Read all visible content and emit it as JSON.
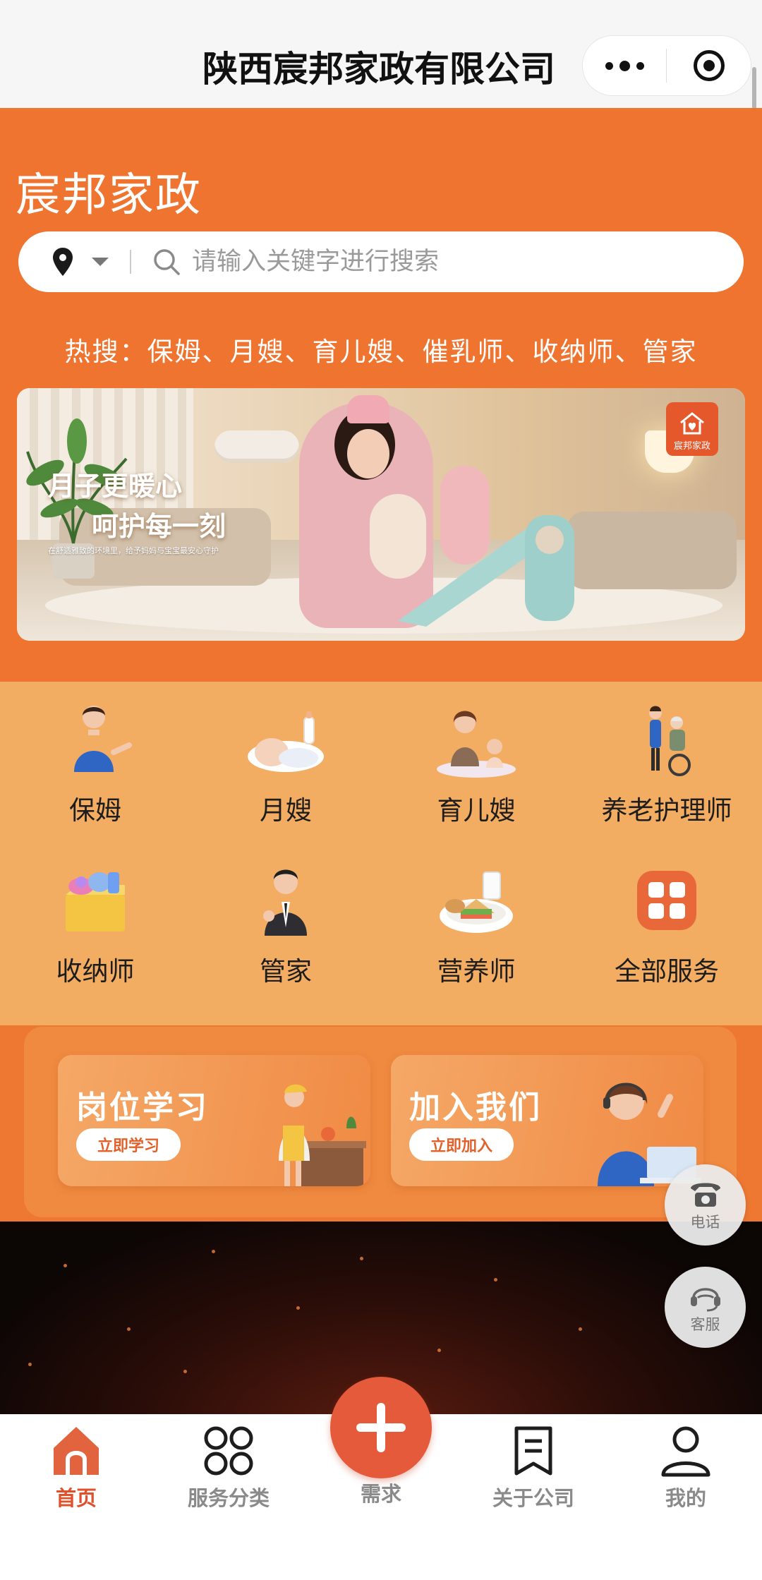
{
  "nav": {
    "title": "陕西宸邦家政有限公司"
  },
  "header": {
    "brand": "宸邦家政",
    "search_placeholder": "请输入关键字进行搜索",
    "hot_search": "热搜：保姆、月嫂、育儿嫂、催乳师、收纳师、管家"
  },
  "banner": {
    "line1": "月子更暖心",
    "line2": "呵护每一刻",
    "line3": "在舒适雅致的环境里，给予妈妈与宝宝最安心守护",
    "logo_text": "宸邦家政"
  },
  "services": [
    {
      "label": "保姆",
      "icon": "nanny-icon"
    },
    {
      "label": "月嫂",
      "icon": "newborn-icon"
    },
    {
      "label": "育儿嫂",
      "icon": "childcare-icon"
    },
    {
      "label": "养老护理师",
      "icon": "elderly-care-icon"
    },
    {
      "label": "收纳师",
      "icon": "organizer-icon"
    },
    {
      "label": "管家",
      "icon": "butler-icon"
    },
    {
      "label": "营养师",
      "icon": "nutritionist-icon"
    },
    {
      "label": "全部服务",
      "icon": "all-services-icon"
    }
  ],
  "promos": [
    {
      "title": "岗位学习",
      "button": "立即学习"
    },
    {
      "title": "加入我们",
      "button": "立即加入"
    }
  ],
  "floating": {
    "phone": "电话",
    "service": "客服"
  },
  "tabs": [
    {
      "label": "首页"
    },
    {
      "label": "服务分类"
    },
    {
      "label": "需求"
    },
    {
      "label": "关于公司"
    },
    {
      "label": "我的"
    }
  ],
  "colors": {
    "accent": "#ee7430",
    "active_tab": "#e0502b",
    "grid_bg": "#f3ad62"
  }
}
